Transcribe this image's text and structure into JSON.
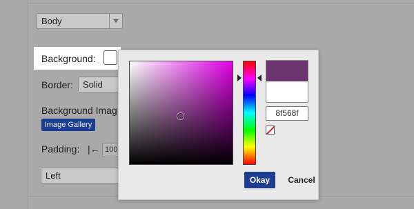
{
  "element_select": {
    "value": "Body"
  },
  "background": {
    "label": "Background:"
  },
  "border": {
    "label": "Border:",
    "value": "Solid"
  },
  "background_image": {
    "label": "Background Imag",
    "gallery_button": "Image Gallery"
  },
  "padding": {
    "label": "Padding:",
    "icon": "|←",
    "value": "100"
  },
  "align_select": {
    "value": "Left"
  },
  "color_picker": {
    "hex": "8f568f",
    "current_color": "#6b3470",
    "ok_label": "Okay",
    "cancel_label": "Cancel"
  }
}
